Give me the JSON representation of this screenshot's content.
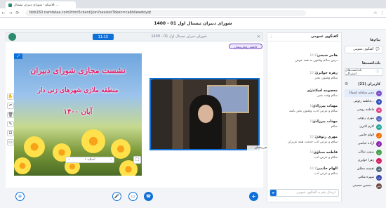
{
  "browser": {
    "tab_title": "کلاسکو - شورای دبیران تیسنال ...",
    "url": "bbb160.namtelaa.com/html5client/join?sessionToken=cabhilewdoyqt"
  },
  "header": {
    "title": "شورای دبیران تیسنال اول 01 - 1400"
  },
  "presentation": {
    "timer": "11:15",
    "title": "شورای دبیران تیسنال اول 01 - 1400",
    "slide_label": "اسلاید ۱",
    "presenter_badge": "فاطمه رئوفی‌پیشان"
  },
  "slide": {
    "line1": "نشست مجازی شورای دبیران",
    "line2": "منطقه ملازی شهرهای زنی دار",
    "line3": "آبان ۱۴۰۰"
  },
  "webcam": {
    "name": "فاطمه رئوفی‌پیشان"
  },
  "chat": {
    "title": "گفتگوی عمومی",
    "messages": [
      {
        "name": "هاجر شیخی",
        "time": "10:12",
        "text": "درس سلام وقتتون به همه خوش"
      },
      {
        "name": "زهره خوایزی",
        "time": "10:12",
        "text": "سلام وقتتون بخیر"
      },
      {
        "name": "معصومه اسکندری",
        "time": "10:13",
        "text": "سلام وقت بخیر"
      },
      {
        "name": "مهتاب پیرزادی",
        "time": "10:13",
        "text": "سلام و عرض ادب، وقتتون بخیر باشه"
      },
      {
        "name": "مهتاب پیرزادی",
        "time": "10:13",
        "text": "سلام"
      },
      {
        "name": "مهری رئوفی",
        "time": "10:14",
        "text": "سلام و عرض ادب خدمت همه عزیزان"
      },
      {
        "name": "فاطمه سناوی",
        "time": "10:14",
        "text": "سلام و عرض ادب"
      },
      {
        "name": "الهام حاتمی",
        "time": "10:15",
        "text": "سلام و عرض ادب"
      }
    ],
    "input_placeholder": "ارسال پیام به گفتگوی عمومی"
  },
  "sidebar": {
    "messages_title": "پیام‌ها",
    "public_chat": "گفتگوی عمومی",
    "notes_title": "یادداشت‌ها",
    "shared_notes": "یادداشت‌های اشتراکی",
    "users_title": "کاربران (21)",
    "users": [
      {
        "name": "مدیر سامانه (شما)",
        "initials": "مد",
        "color": "#7b4fc9"
      },
      {
        "name": "فاطمه رئوفی...",
        "initials": "فا",
        "color": "#2f4fb8"
      },
      {
        "name": "فاطمه روحی",
        "initials": "فا",
        "color": "#e24a8a"
      },
      {
        "name": "مهری رئوفی",
        "initials": "مه",
        "color": "#5c6bc0"
      },
      {
        "name": "اکرم اکبری",
        "initials": "اک",
        "color": "#26a69a"
      },
      {
        "name": "الهام حاتمی",
        "initials": "ال",
        "color": "#ef6c00"
      },
      {
        "name": "آزاده عباسی",
        "initials": "آز",
        "color": "#8e24aa"
      },
      {
        "name": "پروین توکلی",
        "initials": "پر",
        "color": "#43a047"
      },
      {
        "name": "زهرا خوایزی",
        "initials": "زه",
        "color": "#d81b60"
      },
      {
        "name": "نفیسه مطلق",
        "initials": "نف",
        "color": "#546e7a"
      },
      {
        "name": "شهره منافی",
        "initials": "شه",
        "color": "#3949ab"
      },
      {
        "name": "حسین حسینی...",
        "initials": "حس",
        "color": "#6d4c41"
      }
    ]
  },
  "colors": {
    "accent": "#0f70d7",
    "danger": "#e24a4a",
    "brand": "#2c8a6f"
  }
}
